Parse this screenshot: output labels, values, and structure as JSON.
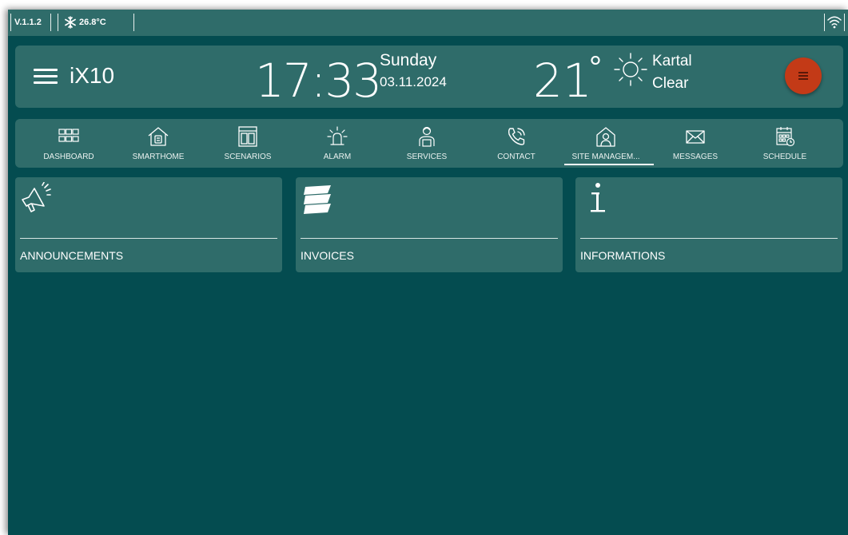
{
  "statusbar": {
    "version": "V.1.1.2",
    "temperature": "26.8°C",
    "icons": [
      "snowflake-icon",
      "wifi-icon"
    ]
  },
  "header": {
    "brand": "iX10",
    "time": "17:33",
    "day": "Sunday",
    "date": "03.11.2024",
    "temperature": "21",
    "degree_symbol": "°",
    "city": "Kartal",
    "condition": "Clear",
    "menu_button_color": "#c33a17"
  },
  "nav": {
    "items": [
      {
        "label": "DASHBOARD",
        "icon": "grid-icon"
      },
      {
        "label": "SMARTHOME",
        "icon": "smarthome-icon"
      },
      {
        "label": "SCENARIOS",
        "icon": "scenarios-icon"
      },
      {
        "label": "ALARM",
        "icon": "alarm-icon"
      },
      {
        "label": "SERVICES",
        "icon": "services-icon"
      },
      {
        "label": "CONTACT",
        "icon": "phone-icon"
      },
      {
        "label": "SITE MANAGEM...",
        "icon": "site-management-icon",
        "active": true
      },
      {
        "label": "MESSAGES",
        "icon": "envelope-icon"
      },
      {
        "label": "SCHEDULE",
        "icon": "calendar-icon"
      }
    ]
  },
  "cards": [
    {
      "label": "ANNOUNCEMENTS",
      "icon": "megaphone-icon"
    },
    {
      "label": "INVOICES",
      "icon": "invoice-icon"
    },
    {
      "label": "INFORMATIONS",
      "icon": "info-icon"
    }
  ],
  "colors": {
    "background": "#044c50",
    "panel": "#2f6c6a",
    "accent": "#c33a17"
  }
}
